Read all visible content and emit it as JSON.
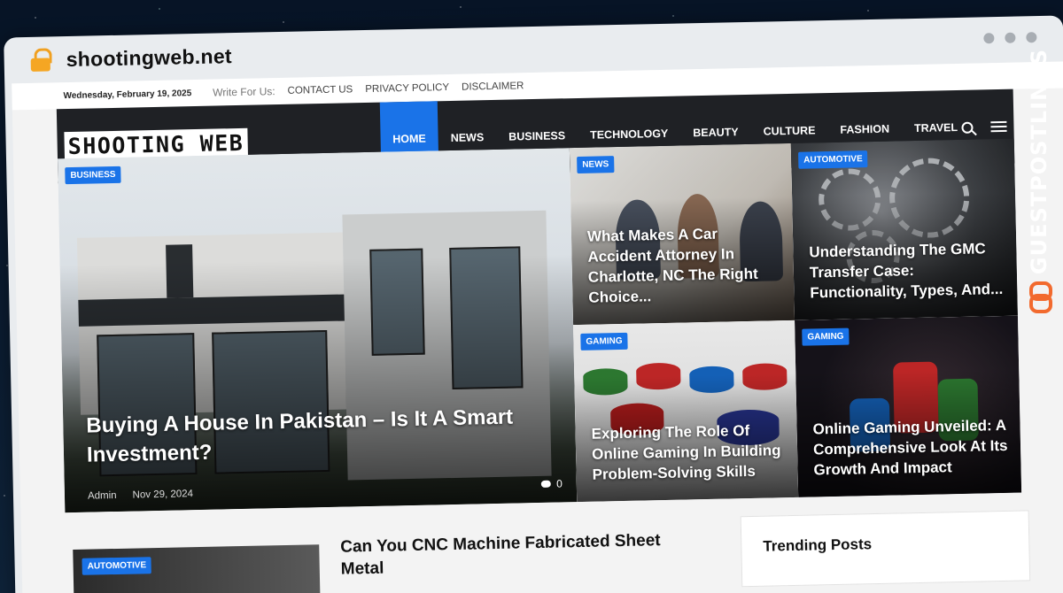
{
  "browser": {
    "url": "shootingweb.net"
  },
  "watermark": {
    "text": "GUESTPOSTLINKS"
  },
  "topbar": {
    "date": "Wednesday, February 19, 2025",
    "write_label": "Write For Us:",
    "links": [
      "CONTACT US",
      "PRIVACY POLICY",
      "DISCLAIMER"
    ]
  },
  "header": {
    "logo": "SHOOTING WEB",
    "nav": [
      "HOME",
      "NEWS",
      "BUSINESS",
      "TECHNOLOGY",
      "BEAUTY",
      "CULTURE",
      "FASHION",
      "TRAVEL"
    ],
    "active_nav": "HOME",
    "accent": "#1a73e8"
  },
  "featured": {
    "main": {
      "category": "BUSINESS",
      "title": "Buying A House In Pakistan – Is It A Smart Investment?",
      "author": "Admin",
      "date": "Nov 29, 2024",
      "comments": "0"
    },
    "cards": [
      {
        "category": "NEWS",
        "title": "What Makes A Car Accident Attorney In Charlotte, NC The Right Choice..."
      },
      {
        "category": "AUTOMOTIVE",
        "title": "Understanding The GMC Transfer Case: Functionality, Types, And..."
      },
      {
        "category": "GAMING",
        "title": "Exploring The Role Of Online Gaming In Building Problem-Solving Skills"
      },
      {
        "category": "GAMING",
        "title": "Online Gaming Unveiled: A Comprehensive Look At Its Growth And Impact"
      }
    ]
  },
  "lower": {
    "category": "AUTOMOTIVE",
    "title": "Can You CNC Machine Fabricated Sheet Metal",
    "trending_title": "Trending Posts"
  }
}
